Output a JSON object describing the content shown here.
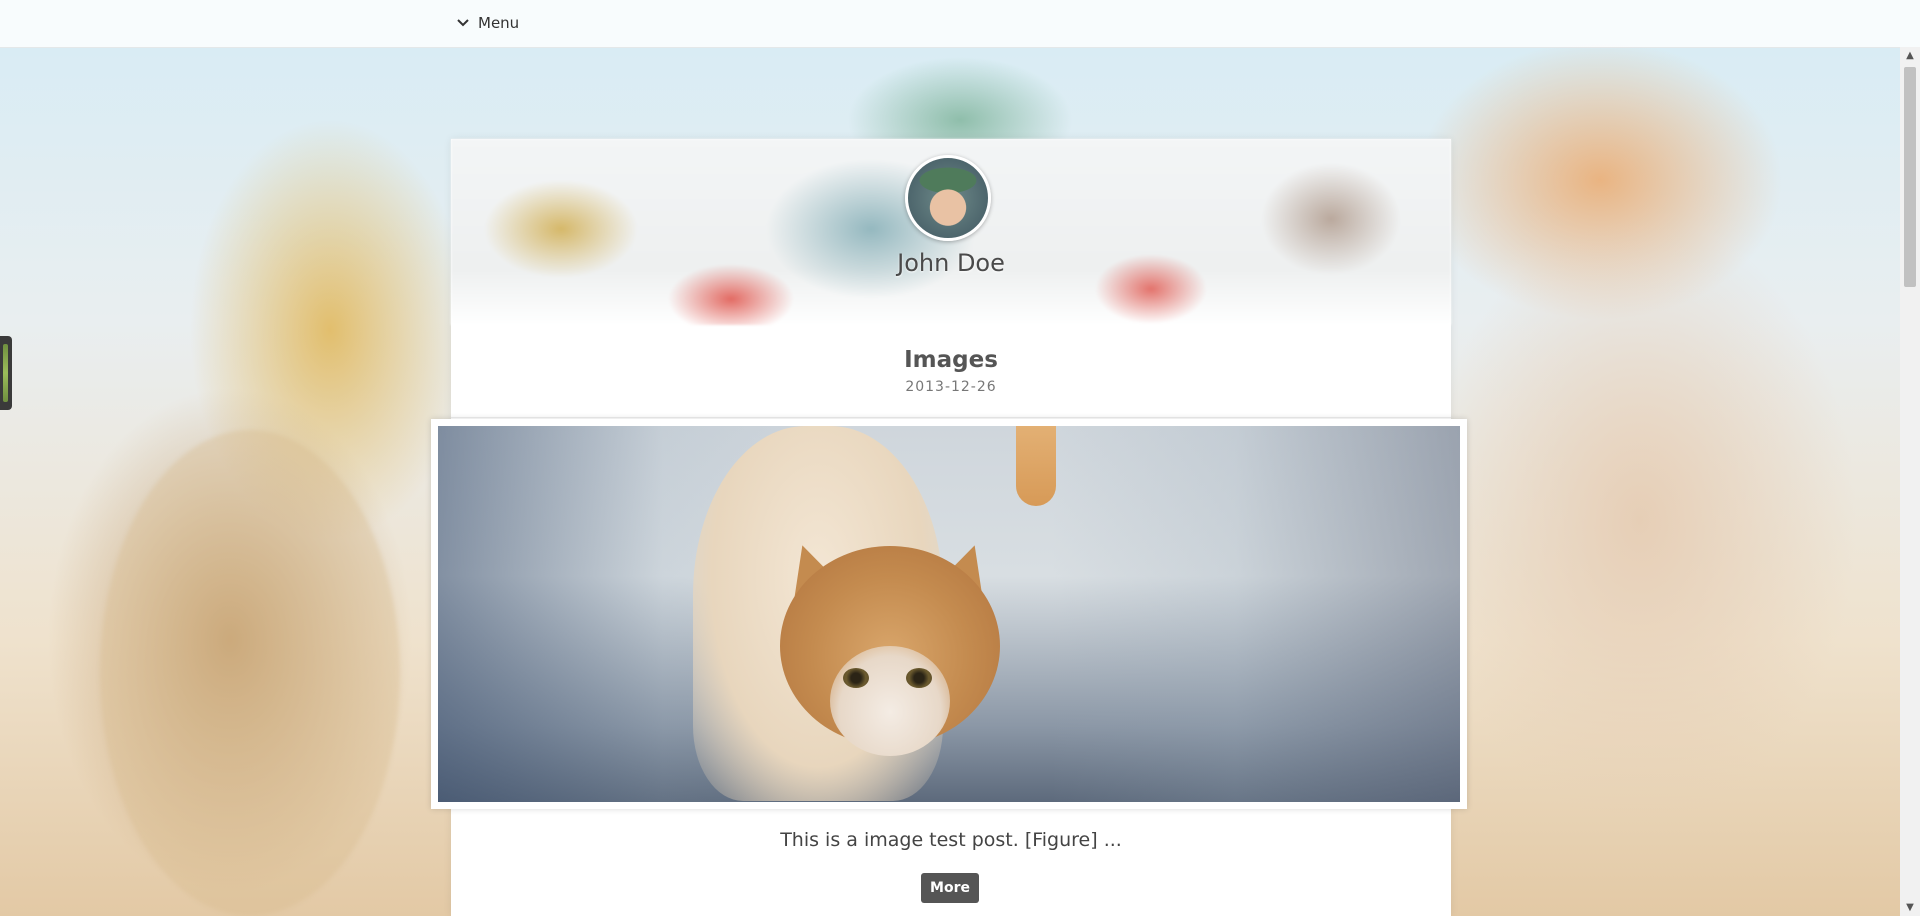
{
  "topbar": {
    "menu_label": "Menu",
    "menu_icon": "chevron-down-icon"
  },
  "sidebar_header": {
    "author_name": "John Doe"
  },
  "post": {
    "title": "Images",
    "date": "2013-12-26",
    "excerpt": "This is a image test post. [Figure] ...",
    "more_label": "More"
  },
  "colors": {
    "more_button_bg": "#555555",
    "text_primary": "#444444",
    "card_bg": "#ffffff"
  }
}
